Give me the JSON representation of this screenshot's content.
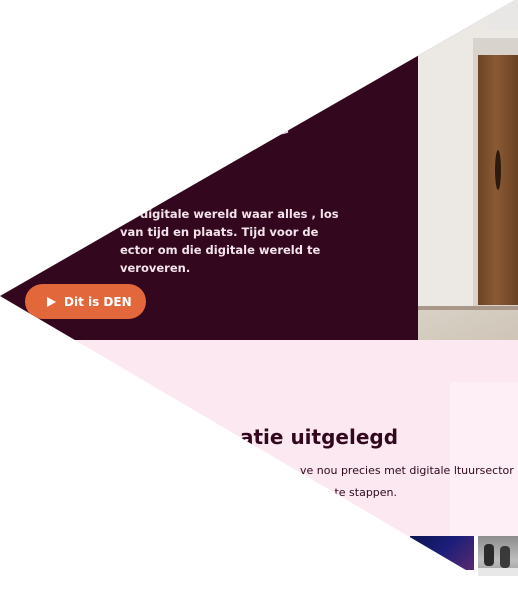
{
  "hero": {
    "title": "?\nan de\n?",
    "lead": "en digitale wereld waar alles , los van tijd en plaats. Tijd voor de ector om die digitale wereld te veroveren.",
    "cta_label": "Dit is DEN"
  },
  "section": {
    "title": "atie uitgelegd",
    "text": "ve nou precies met digitale ltuursector om in te stappen."
  },
  "colors": {
    "hero_bg": "#33081f",
    "accent": "#e2683b",
    "pink_bg": "#fbe8f1",
    "text_dark": "#33081f"
  },
  "icons": {
    "cta_icon": "play-icon"
  }
}
